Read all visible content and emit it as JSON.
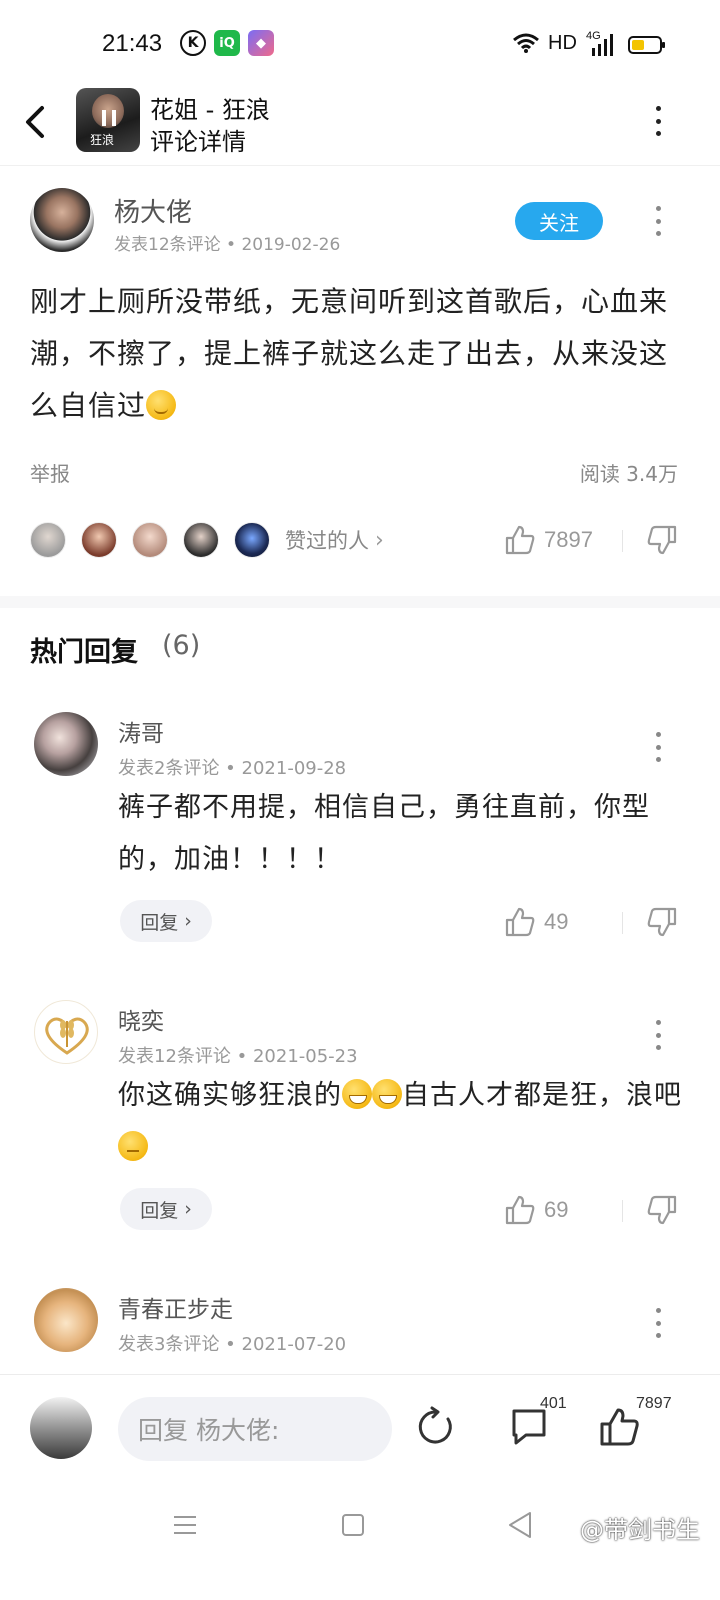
{
  "status_bar": {
    "time": "21:43",
    "network_label": "HD",
    "signal_label": "4G",
    "icons": [
      "k-app-icon",
      "iqiyi-icon",
      "app-icon",
      "wifi-icon",
      "signal-icon",
      "battery-icon"
    ],
    "battery_color": "#f3c400"
  },
  "header": {
    "song_title": "花姐 - 狂浪",
    "subtitle": "评论详情",
    "cover_text": "狂浪"
  },
  "post": {
    "author": "杨大佬",
    "meta": "发表12条评论 • 2019-02-26",
    "follow_label": "关注",
    "body_text": "刚才上厕所没带纸，无意间听到这首歌后，心血来潮，不擦了，提上裤子就这么走了出去，从来没这么自信过",
    "report_label": "举报",
    "reads_label": "阅读 3.4万",
    "likers_label": "赞过的人",
    "like_count": "7897",
    "accent_color": "#27a8ee"
  },
  "hot_replies": {
    "title": "热门回复",
    "count": "(6)",
    "items": [
      {
        "name": "涛哥",
        "meta": "发表2条评论 • 2021-09-28",
        "text": "裤子都不用提，相信自己，勇往直前，你型的，加油！！！！",
        "reply_label": "回复",
        "likes": "49"
      },
      {
        "name": "晓奕",
        "meta": "发表12条评论 • 2021-05-23",
        "text_part1": "你这确实够狂浪的",
        "text_part2": "自古人才都是狂，浪吧",
        "reply_label": "回复",
        "likes": "69"
      },
      {
        "name": "青春正步走",
        "meta": "发表3条评论 • 2021-07-20"
      }
    ]
  },
  "bottom_bar": {
    "reply_placeholder": "回复 杨大佬:",
    "comment_count": "401",
    "like_count": "7897"
  },
  "watermark": "@带剑书生"
}
